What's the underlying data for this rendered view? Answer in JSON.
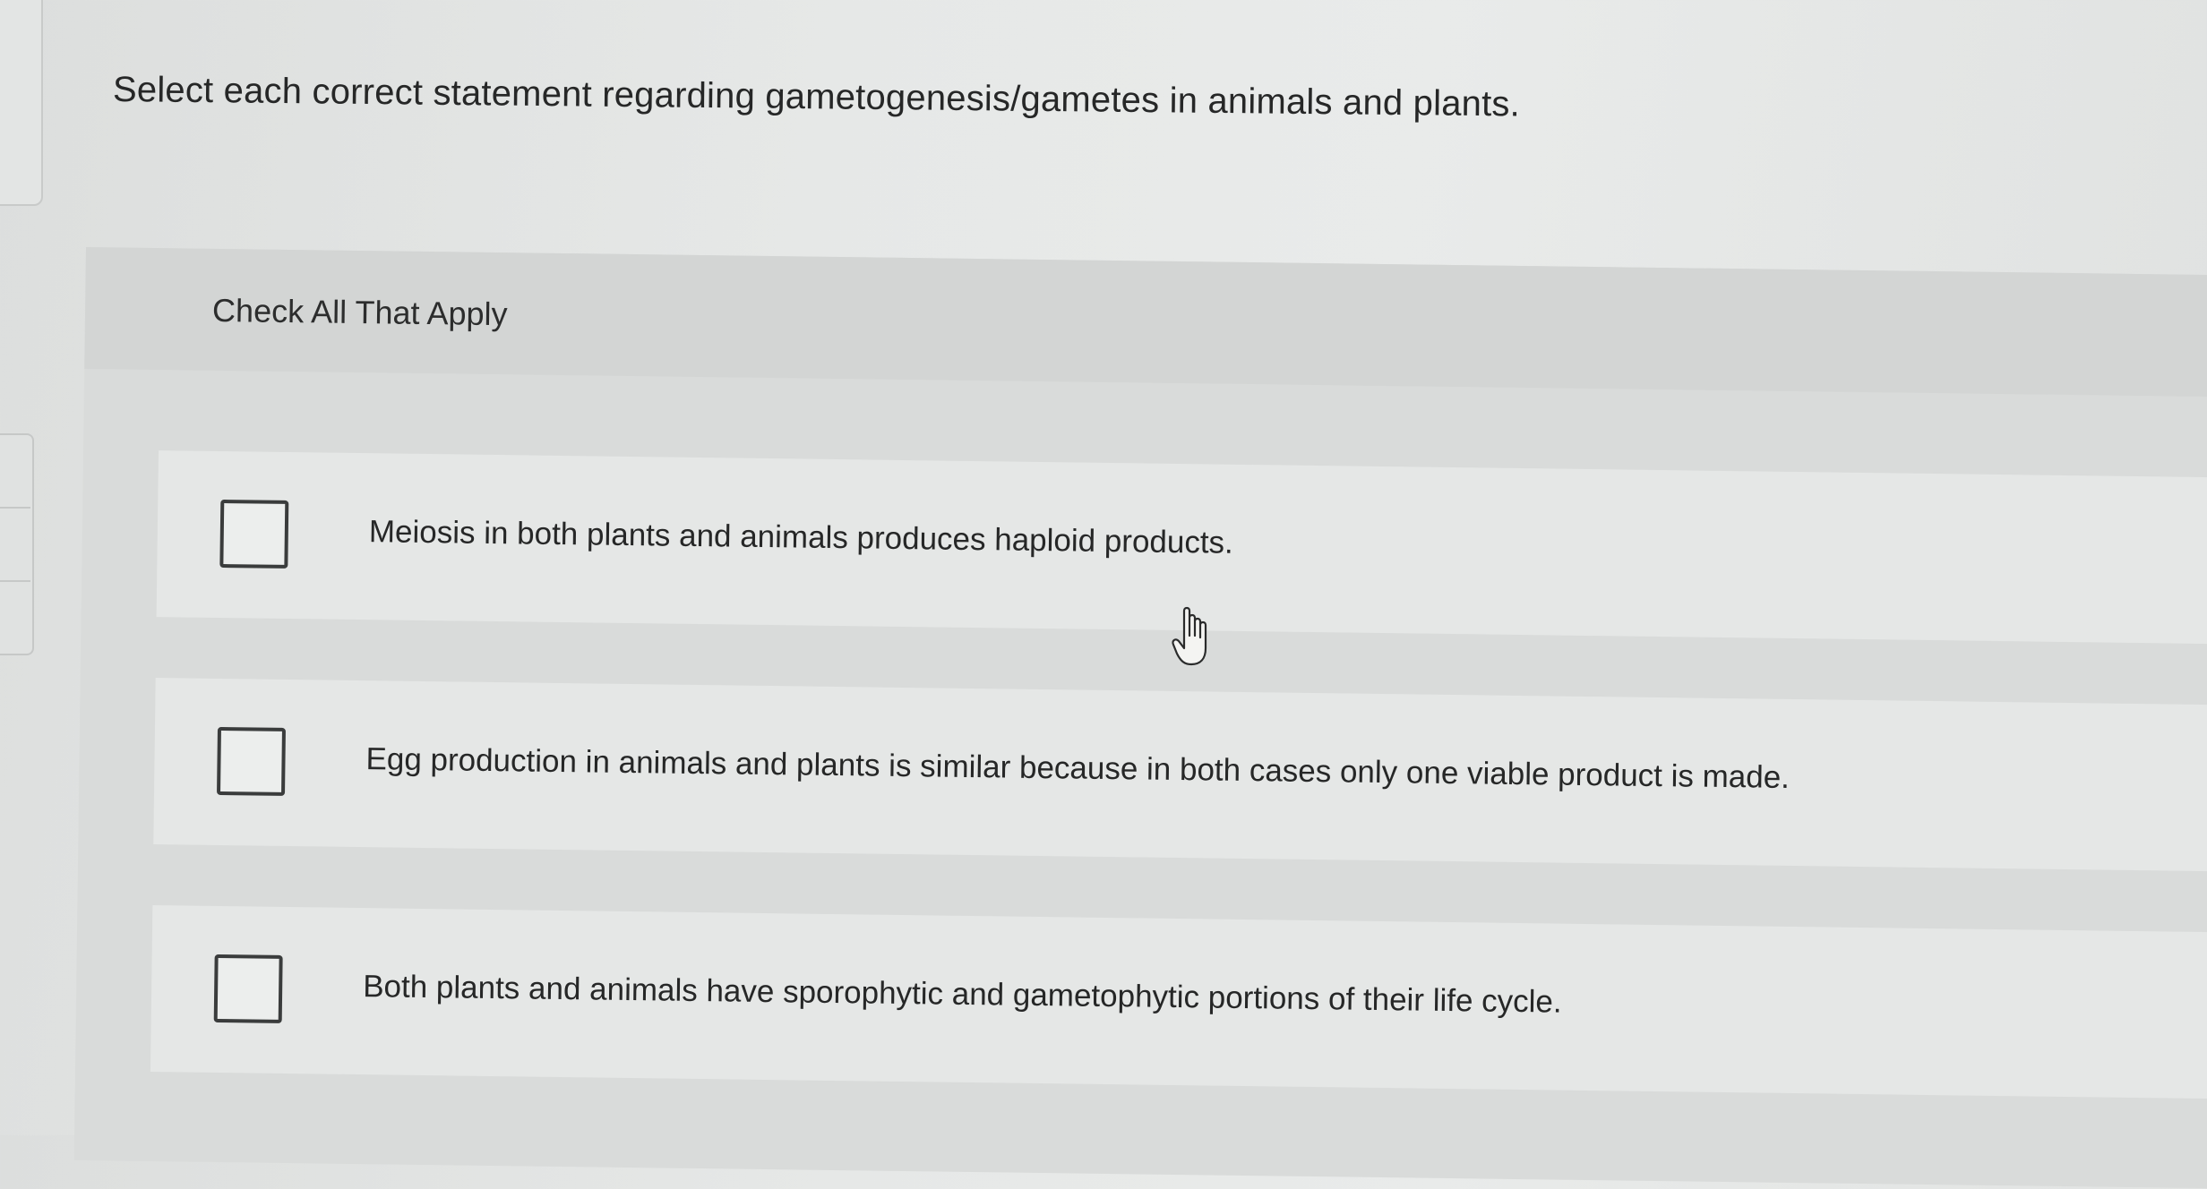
{
  "question": {
    "text": "Select each correct statement regarding gametogenesis/gametes in animals and plants."
  },
  "panel": {
    "instruction": "Check All That Apply"
  },
  "options": [
    {
      "label": "Meiosis in both plants and animals produces haploid products.",
      "checked": false
    },
    {
      "label": "Egg production in animals and plants is similar because in both cases only one viable product is made.",
      "checked": false
    },
    {
      "label": "Both plants and animals have sporophytic and gametophytic portions of their life cycle.",
      "checked": false
    }
  ],
  "cursor": {
    "icon": "hand-pointer-icon"
  }
}
